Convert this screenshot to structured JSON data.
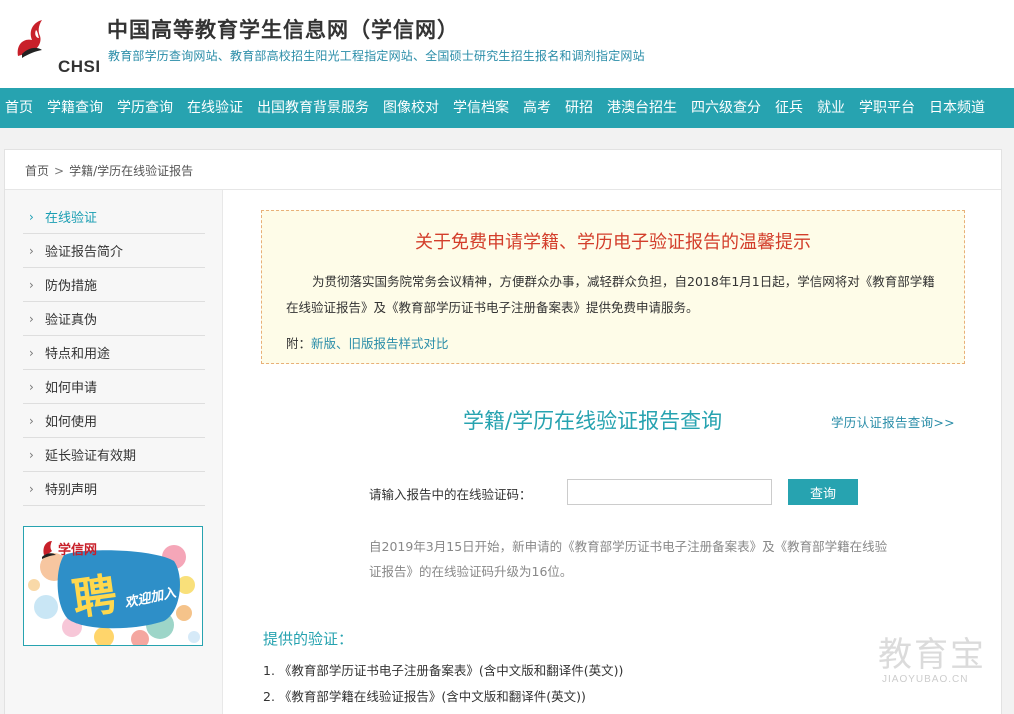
{
  "header": {
    "logo_text": "CHSI",
    "title": "中国高等教育学生信息网（学信网）",
    "subtitle": "教育部学历查询网站、教育部高校招生阳光工程指定网站、全国硕士研究生招生报名和调剂指定网站"
  },
  "nav": [
    "首页",
    "学籍查询",
    "学历查询",
    "在线验证",
    "出国教育背景服务",
    "图像校对",
    "学信档案",
    "高考",
    "研招",
    "港澳台招生",
    "四六级查分",
    "征兵",
    "就业",
    "学职平台",
    "日本频道"
  ],
  "breadcrumb": {
    "home": "首页",
    "sep": ">",
    "current": "学籍/学历在线验证报告"
  },
  "sidebar": [
    {
      "label": "在线验证"
    },
    {
      "label": "验证报告简介"
    },
    {
      "label": "防伪措施"
    },
    {
      "label": "验证真伪"
    },
    {
      "label": "特点和用途"
    },
    {
      "label": "如何申请"
    },
    {
      "label": "如何使用"
    },
    {
      "label": "延长验证有效期"
    },
    {
      "label": "特别声明"
    }
  ],
  "banner": {
    "brand": "学信网",
    "big": "聘",
    "tagline": "欢迎加入"
  },
  "notice": {
    "title": "关于免费申请学籍、学历电子验证报告的温馨提示",
    "body": "为贯彻落实国务院常务会议精神，方便群众办事，减轻群众负担，自2018年1月1日起，学信网将对《教育部学籍在线验证报告》及《教育部学历证书电子注册备案表》提供免费申请服务。",
    "attach_prefix": "附：",
    "attach_link": "新版、旧版报告样式对比"
  },
  "query": {
    "title": "学籍/学历在线验证报告查询",
    "alt_link": "学历认证报告查询>>",
    "label": "请输入报告中的在线验证码：",
    "input_value": "",
    "button": "查询",
    "note": "自2019年3月15日开始，新申请的《教育部学历证书电子注册备案表》及《教育部学籍在线验证报告》的在线验证码升级为16位。"
  },
  "provided": {
    "title": "提供的验证：",
    "items": [
      "1. 《教育部学历证书电子注册备案表》(含中文版和翻译件(英文))",
      "2. 《教育部学籍在线验证报告》(含中文版和翻译件(英文))"
    ]
  },
  "watermark": {
    "cn": "教育宝",
    "en": "JIAOYUBAO.CN"
  },
  "colors": {
    "teal": "#27a3b0",
    "red": "#d33e2b",
    "link": "#2a8da8"
  }
}
